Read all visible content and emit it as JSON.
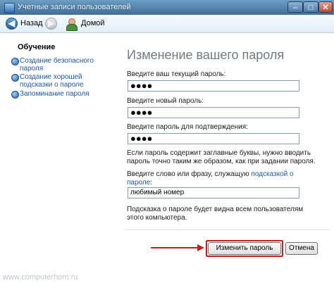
{
  "window": {
    "title": "Учетные записи пользователей"
  },
  "toolbar": {
    "back_label": "Назад",
    "home_label": "Домой"
  },
  "sidebar": {
    "heading": "Обучение",
    "items": [
      {
        "line1": "Создание безопасного",
        "line2": "пароля"
      },
      {
        "line1": "Создание хорошей",
        "line2": "подсказки о пароле"
      },
      {
        "line1": "Запоминание пароля",
        "line2": ""
      }
    ]
  },
  "watermark": "www.computerhom.ru",
  "main": {
    "title": "Изменение вашего пароля",
    "current_label": "Введите ваш текущий пароль:",
    "current_value": "●●●●",
    "new_label": "Введите новый пароль:",
    "new_value": "●●●●",
    "confirm_label": "Введите пароль для подтверждения:",
    "confirm_value": "●●●●",
    "note_line1": "Если пароль содержит заглавные буквы, нужно вводить",
    "note_line2": "пароль точно таким же образом, как при задании пароля.",
    "hint_prefix": "Введите слово или фразу, служащую ",
    "hint_link1": "подсказкой о",
    "hint_link2": "пароле",
    "hint_suffix": ":",
    "hint_value": "любимый номер",
    "hint_info_line1": "Подсказка о пароле будет видна всем пользователям",
    "hint_info_line2": "этого компьютера."
  },
  "buttons": {
    "change": "Изменить пароль",
    "cancel": "Отмена"
  },
  "colors": {
    "link": "#1b56a8",
    "title_gray": "#6e7a86",
    "highlight_red": "#c1201c"
  }
}
